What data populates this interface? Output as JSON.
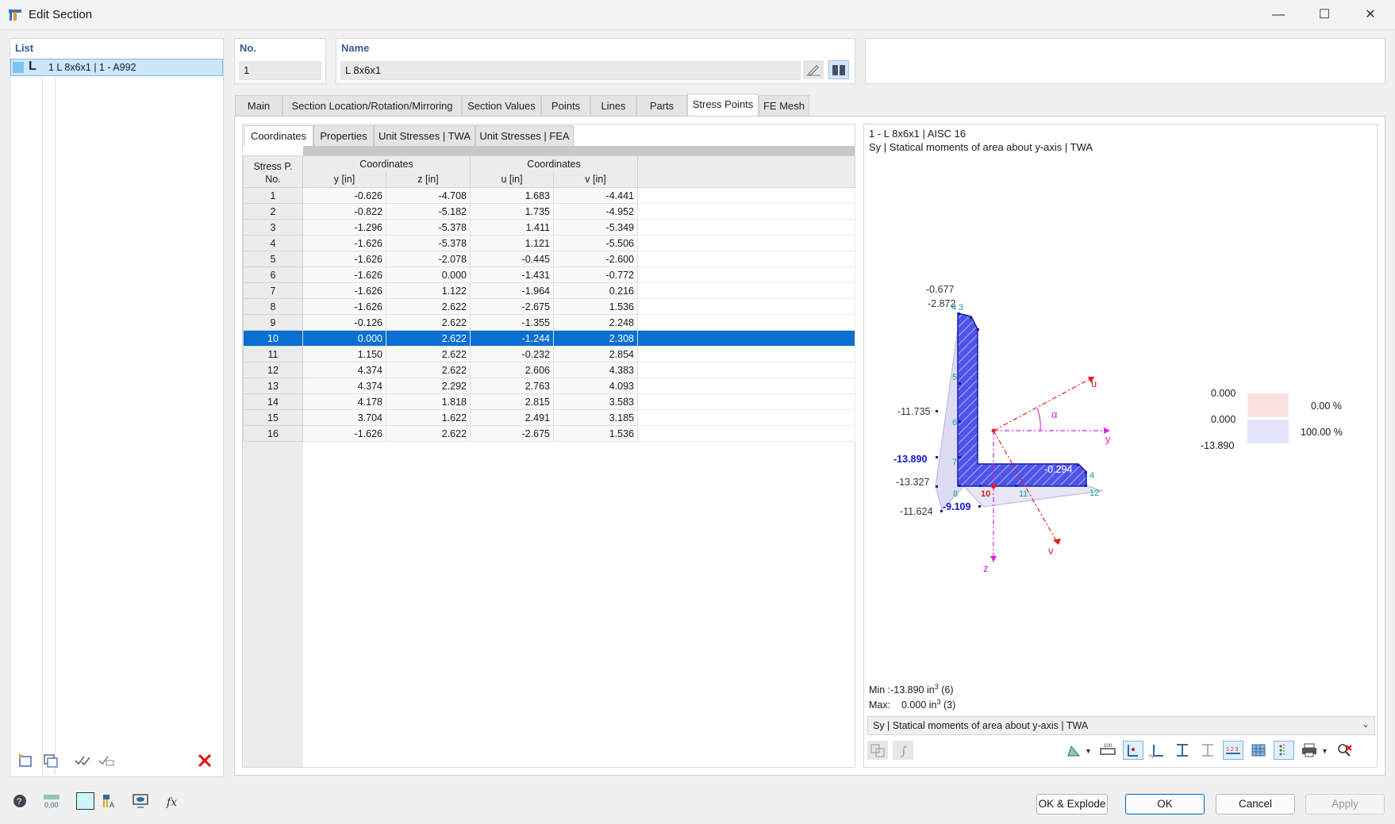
{
  "window": {
    "title": "Edit Section",
    "minimize": "—",
    "maximize": "☐",
    "close": "✕"
  },
  "list": {
    "label": "List",
    "items": [
      {
        "icon_text": "L",
        "text": "1  L 8x6x1 | 1 - A992"
      }
    ]
  },
  "no_field": {
    "label": "No.",
    "value": "1"
  },
  "name_field": {
    "label": "Name",
    "value": "L 8x6x1"
  },
  "tabs": [
    {
      "label": "Main"
    },
    {
      "label": "Section Location/Rotation/Mirroring"
    },
    {
      "label": "Section Values"
    },
    {
      "label": "Points"
    },
    {
      "label": "Lines"
    },
    {
      "label": "Parts"
    },
    {
      "label": "Stress Points"
    },
    {
      "label": "FE Mesh"
    }
  ],
  "subtabs": [
    {
      "label": "Coordinates"
    },
    {
      "label": "Properties"
    },
    {
      "label": "Unit Stresses | TWA"
    },
    {
      "label": "Unit Stresses | FEA"
    }
  ],
  "table": {
    "header": {
      "no_line1": "Stress P.",
      "no_line2": "No.",
      "group1": "Coordinates",
      "group2": "Coordinates",
      "y": "y [in]",
      "z": "z [in]",
      "u": "u [in]",
      "v": "v [in]"
    },
    "rows": [
      {
        "no": "1",
        "y": "-0.626",
        "z": "-4.708",
        "u": "1.683",
        "v": "-4.441"
      },
      {
        "no": "2",
        "y": "-0.822",
        "z": "-5.182",
        "u": "1.735",
        "v": "-4.952"
      },
      {
        "no": "3",
        "y": "-1.296",
        "z": "-5.378",
        "u": "1.411",
        "v": "-5.349"
      },
      {
        "no": "4",
        "y": "-1.626",
        "z": "-5.378",
        "u": "1.121",
        "v": "-5.506"
      },
      {
        "no": "5",
        "y": "-1.626",
        "z": "-2.078",
        "u": "-0.445",
        "v": "-2.600"
      },
      {
        "no": "6",
        "y": "-1.626",
        "z": "0.000",
        "u": "-1.431",
        "v": "-0.772"
      },
      {
        "no": "7",
        "y": "-1.626",
        "z": "1.122",
        "u": "-1.964",
        "v": "0.216"
      },
      {
        "no": "8",
        "y": "-1.626",
        "z": "2.622",
        "u": "-2.675",
        "v": "1.536"
      },
      {
        "no": "9",
        "y": "-0.126",
        "z": "2.622",
        "u": "-1.355",
        "v": "2.248"
      },
      {
        "no": "10",
        "y": "0.000",
        "z": "2.622",
        "u": "-1.244",
        "v": "2.308"
      },
      {
        "no": "11",
        "y": "1.150",
        "z": "2.622",
        "u": "-0.232",
        "v": "2.854"
      },
      {
        "no": "12",
        "y": "4.374",
        "z": "2.622",
        "u": "2.606",
        "v": "4.383"
      },
      {
        "no": "13",
        "y": "4.374",
        "z": "2.292",
        "u": "2.763",
        "v": "4.093"
      },
      {
        "no": "14",
        "y": "4.178",
        "z": "1.818",
        "u": "2.815",
        "v": "3.583"
      },
      {
        "no": "15",
        "y": "3.704",
        "z": "1.622",
        "u": "2.491",
        "v": "3.185"
      },
      {
        "no": "16",
        "y": "-1.626",
        "z": "2.622",
        "u": "-2.675",
        "v": "1.536"
      }
    ],
    "selected_row": "10"
  },
  "diagram": {
    "title_line1": "1 - L 8x6x1 | AISC 16",
    "title_line2": "Sy | Statical moments of area about y-axis | TWA",
    "labels": {
      "v1": "-0.677",
      "v2": "-2.872",
      "v3": "-11.735",
      "v4": "-13.890",
      "v5": "-13.327",
      "v6": "-11.624",
      "v7": "-9.109",
      "v8": "-0.294",
      "axis_u": "u",
      "axis_v": "v",
      "axis_y": "y",
      "axis_z": "z",
      "alpha": "α"
    },
    "point_labels": [
      "4",
      "3",
      "5",
      "6",
      "7",
      "8",
      "10",
      "11",
      "12",
      "4"
    ],
    "legend": {
      "rows": [
        {
          "value": "0.000",
          "percent": "0.00 %"
        },
        {
          "value": "0.000",
          "percent": "100.00 %"
        },
        {
          "value": "-13.890",
          "percent": ""
        }
      ],
      "colors": [
        "#fbe3e3",
        "#e3e3fb"
      ]
    },
    "min_label": "Min :",
    "min_value": "-13.890",
    "min_unit": "in",
    "min_exp": "3",
    "min_idx": "(6)",
    "max_label": "Max:",
    "max_value": "0.000",
    "max_unit": "in",
    "max_exp": "3",
    "max_idx": "(3)",
    "dropdown_value": "Sy | Statical moments of area about y-axis | TWA"
  },
  "footer": {
    "ok_explode": "OK & Explode",
    "ok": "OK",
    "cancel": "Cancel",
    "apply": "Apply"
  },
  "colors": {
    "selection": "#0a6fd1",
    "section_fill": "#4f54e8",
    "axis_magenta": "#e020e0",
    "axis_red": "#e02020",
    "highlight_blue": "#1414c8"
  }
}
